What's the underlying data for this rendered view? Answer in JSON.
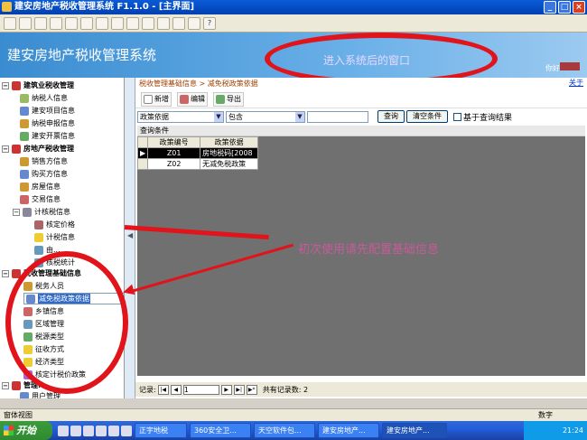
{
  "window": {
    "title": "建安房地产税收管理系统 F1.1.0 - [主界面]",
    "min": "_",
    "max": "□",
    "close": "×"
  },
  "banner": {
    "app_title": "建安房地产税收管理系统",
    "annotation": "进入系统后的窗口",
    "user_label": "你好"
  },
  "sidebar": {
    "groups": [
      {
        "label": "建筑业税收管理",
        "items": [
          "纳税人信息",
          "建安项目信息",
          "纳税申报信息",
          "建安开票信息"
        ]
      },
      {
        "label": "房地产税收管理",
        "items": [
          "销售方信息",
          "购买方信息",
          "房屋信息",
          "交易信息",
          "计核税信息",
          "核定价格",
          "计税信息",
          "由...",
          "核税统计"
        ]
      },
      {
        "label": "税收管理基础信息",
        "items": [
          "税务人员",
          "减免税政策依据",
          "乡镇信息",
          "区域管理",
          "税源类型",
          "征收方式",
          "经济类型",
          "核定计税价政策"
        ]
      },
      {
        "label": "管理...",
        "items": [
          "用户管理"
        ]
      }
    ],
    "selected": "减免税政策依据"
  },
  "main": {
    "breadcrumb": "税收管理基础信息 > 减免税政策依据",
    "about": "关于",
    "actions": {
      "add": "新增",
      "edit": "编辑",
      "export": "导出"
    },
    "filter": {
      "field": "政策依据",
      "op": "包含",
      "value": "",
      "query": "查询",
      "clear": "清空条件",
      "base_on_results": "基于查询结果"
    },
    "query_header": "查询条件",
    "grid": {
      "columns": [
        "政策编号",
        "政策依据"
      ],
      "rows": [
        [
          "Z01",
          "房地税码[2008"
        ],
        [
          "Z02",
          "无减免税政策"
        ]
      ]
    },
    "pager": {
      "label": "记录:",
      "page": "1",
      "total": "共有记录数: 2"
    }
  },
  "annotation2": "初次使用请先配置基础信息",
  "statusbar": {
    "left": "窗体视图",
    "right": "数字"
  },
  "taskbar": {
    "start": "开始",
    "tasks": [
      "正宇地税",
      "360安全卫...",
      "天空软件包...",
      "建安房地产...",
      "建安房地产..."
    ],
    "clock": "21:24"
  }
}
